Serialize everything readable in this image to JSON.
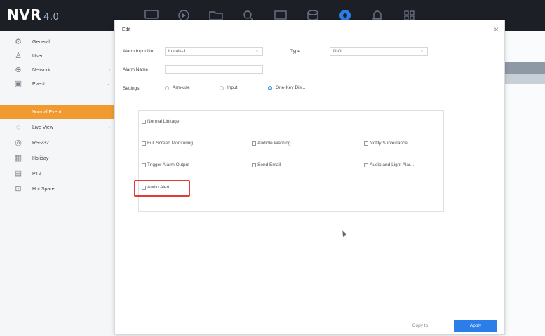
{
  "app": {
    "logo": "NVR",
    "version": "4.0"
  },
  "top_icons": [
    "monitor-icon",
    "playback-icon",
    "folder-icon",
    "search-icon",
    "display-icon",
    "storage-icon",
    "settings-icon",
    "alarm-icon",
    "grid-icon"
  ],
  "sidebar": {
    "items": [
      {
        "label": "General",
        "icon": "gear-icon"
      },
      {
        "label": "User",
        "icon": "user-icon"
      },
      {
        "label": "Network",
        "icon": "network-icon",
        "has_arrow": true
      },
      {
        "label": "Event",
        "icon": "event-icon",
        "has_arrow": true
      },
      {
        "label": "Normal Event",
        "active": true
      },
      {
        "label": "Live View",
        "icon": "live-view-icon",
        "has_arrow": true
      },
      {
        "label": "RS-232",
        "icon": "serial-icon"
      },
      {
        "label": "Holiday",
        "icon": "calendar-icon"
      },
      {
        "label": "PTZ",
        "icon": "ptz-icon"
      },
      {
        "label": "Hot Spare",
        "icon": "hot-spare-icon"
      }
    ]
  },
  "dialog": {
    "title": "Edit",
    "alarm_input_label": "Alarm Input No.",
    "alarm_input_value": "Local<-1",
    "type_label": "Type",
    "type_value": "N.O",
    "alarm_name_label": "Alarm Name",
    "alarm_name_value": "",
    "settings_label": "Settings",
    "settings_options": [
      {
        "label": "Arm-use",
        "selected": false
      },
      {
        "label": "Input",
        "selected": false
      },
      {
        "label": "One-Key Dis...",
        "selected": true
      }
    ],
    "linkage": {
      "normal": "Normal Linkage",
      "options": [
        "Full Screen Monitoring",
        "Audible Warning",
        "Notify Surveillance ...",
        "Trigger Alarm Output",
        "Send Email",
        "Audio and Light Alar...",
        "Audio Alert"
      ]
    },
    "copy_label": "Copy to",
    "apply_label": "Apply"
  }
}
